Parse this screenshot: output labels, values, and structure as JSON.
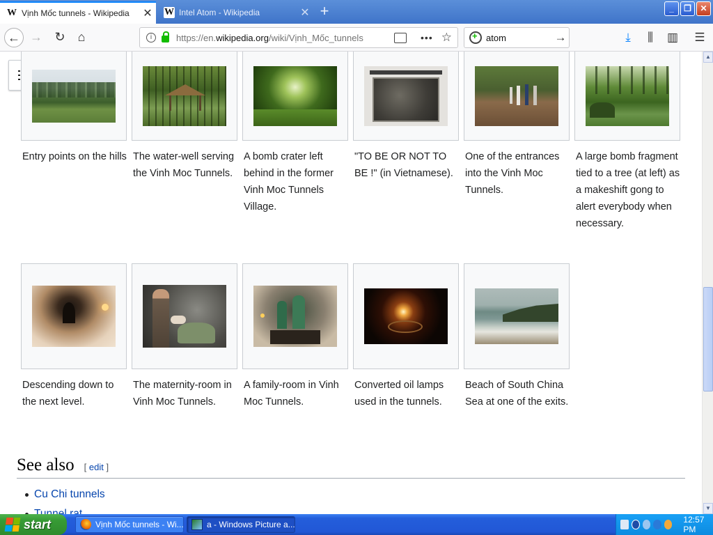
{
  "browser": {
    "tabs": [
      {
        "label": "Vịnh Mốc tunnels - Wikipedia",
        "active": true
      },
      {
        "label": "Intel Atom - Wikipedia",
        "active": false
      }
    ],
    "url_prefix": "https://en.",
    "url_domain": "wikipedia.org",
    "url_path": "/wiki/Vịnh_Mốc_tunnels",
    "search_value": "atom",
    "icons": [
      "back-arrow-icon",
      "forward-arrow-icon",
      "reload-icon",
      "home-icon",
      "info-icon",
      "lock-icon",
      "reader-view-icon",
      "page-actions-icon",
      "bookmark-star-icon",
      "download-icon",
      "library-icon",
      "sidebar-icon",
      "menu-icon"
    ]
  },
  "gallery": {
    "row1": [
      {
        "caption": "Entry points on the hills",
        "thumb": "grass-field-scene"
      },
      {
        "caption": "The water-well serving the Vinh Moc Tunnels.",
        "thumb": "bamboo-hut-scene"
      },
      {
        "caption": "A bomb crater left behind in the former Vinh Moc Tunnels Village.",
        "thumb": "forest-crater-scene"
      },
      {
        "caption": "\"TO BE OR NOT TO BE !\" (in Vietnamese).",
        "thumb": "relief-plaque-scene"
      },
      {
        "caption": "One of the entrances into the Vinh Moc Tunnels.",
        "thumb": "entrance-visitors-scene"
      },
      {
        "caption": "A large bomb fragment tied to a tree (at left) as a makeshift gong to alert everybody when necessary.",
        "thumb": "bomb-fragment-scene"
      }
    ],
    "row2": [
      {
        "caption": "Descending down to the next level.",
        "thumb": "tunnel-corridor-scene"
      },
      {
        "caption": "The maternity-room in Vinh Moc Tunnels.",
        "thumb": "maternity-room-scene"
      },
      {
        "caption": "A family-room in Vinh Moc Tunnels.",
        "thumb": "family-room-scene"
      },
      {
        "caption": "Converted oil lamps used in the tunnels.",
        "thumb": "oil-lamp-scene"
      },
      {
        "caption": "Beach of South China Sea at one of the exits.",
        "thumb": "beach-scene"
      }
    ]
  },
  "see_also": {
    "heading": "See also",
    "edit_open": "[ ",
    "edit_label": "edit",
    "edit_close": " ]",
    "links": [
      "Cu Chi tunnels",
      "Tunnel rat"
    ]
  },
  "taskbar": {
    "start_label": "start",
    "tasks": [
      "Vịnh Mốc tunnels - Wi...",
      "a - Windows Picture a..."
    ],
    "clock": "12:57 PM"
  }
}
